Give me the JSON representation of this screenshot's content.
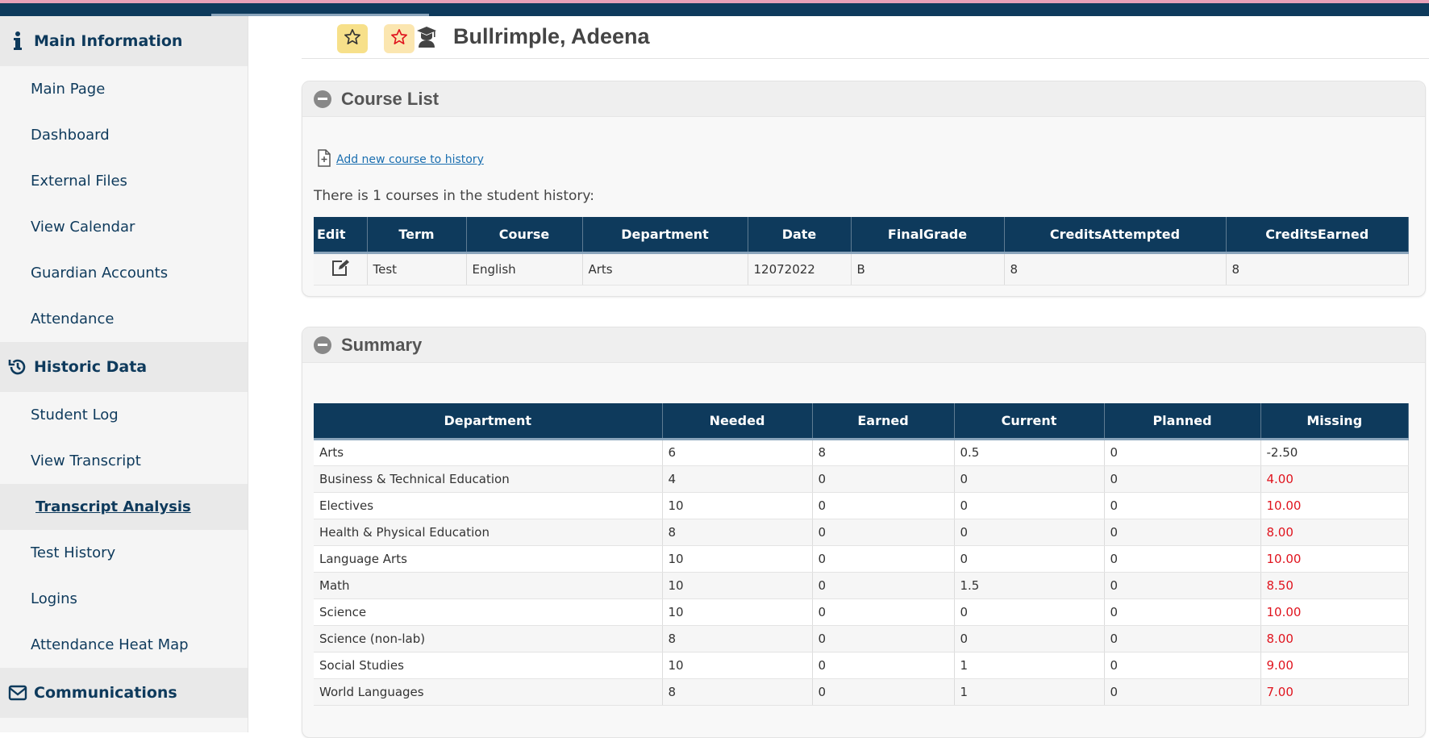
{
  "sidebar": {
    "sections": [
      {
        "label": "Main Information",
        "icon": "info-icon"
      },
      {
        "label": "Historic Data",
        "icon": "history-icon"
      },
      {
        "label": "Communications",
        "icon": "envelope-icon"
      }
    ],
    "main_items": [
      "Main Page",
      "Dashboard",
      "External Files",
      "View Calendar",
      "Guardian Accounts",
      "Attendance"
    ],
    "historic_items": [
      "Student Log",
      "View Transcript",
      "Transcript Analysis",
      "Test History",
      "Logins",
      "Attendance Heat Map"
    ],
    "active_item": "Transcript Analysis"
  },
  "header": {
    "student_name": "Bullrimple, Adeena"
  },
  "course_list": {
    "title": "Course List",
    "add_link": "Add new course to history",
    "count_text": "There is 1 courses in the student history:",
    "columns": [
      "Edit",
      "Term",
      "Course",
      "Department",
      "Date",
      "FinalGrade",
      "CreditsAttempted",
      "CreditsEarned"
    ],
    "rows": [
      {
        "term": "Test",
        "course": "English",
        "department": "Arts",
        "date": "12072022",
        "grade": "B",
        "attempted": "8",
        "earned": "8"
      }
    ]
  },
  "summary": {
    "title": "Summary",
    "columns": [
      "Department",
      "Needed",
      "Earned",
      "Current",
      "Planned",
      "Missing"
    ],
    "rows": [
      {
        "department": "Arts",
        "needed": "6",
        "earned": "8",
        "current": "0.5",
        "planned": "0",
        "missing": "-2.50",
        "deficit": false
      },
      {
        "department": "Business & Technical Education",
        "needed": "4",
        "earned": "0",
        "current": "0",
        "planned": "0",
        "missing": "4.00",
        "deficit": true
      },
      {
        "department": "Electives",
        "needed": "10",
        "earned": "0",
        "current": "0",
        "planned": "0",
        "missing": "10.00",
        "deficit": true
      },
      {
        "department": "Health & Physical Education",
        "needed": "8",
        "earned": "0",
        "current": "0",
        "planned": "0",
        "missing": "8.00",
        "deficit": true
      },
      {
        "department": "Language Arts",
        "needed": "10",
        "earned": "0",
        "current": "0",
        "planned": "0",
        "missing": "10.00",
        "deficit": true
      },
      {
        "department": "Math",
        "needed": "10",
        "earned": "0",
        "current": "1.5",
        "planned": "0",
        "missing": "8.50",
        "deficit": true
      },
      {
        "department": "Science",
        "needed": "10",
        "earned": "0",
        "current": "0",
        "planned": "0",
        "missing": "10.00",
        "deficit": true
      },
      {
        "department": "Science (non-lab)",
        "needed": "8",
        "earned": "0",
        "current": "0",
        "planned": "0",
        "missing": "8.00",
        "deficit": true
      },
      {
        "department": "Social Studies",
        "needed": "10",
        "earned": "0",
        "current": "1",
        "planned": "0",
        "missing": "9.00",
        "deficit": true
      },
      {
        "department": "World Languages",
        "needed": "8",
        "earned": "0",
        "current": "1",
        "planned": "0",
        "missing": "7.00",
        "deficit": true
      }
    ]
  },
  "colors": {
    "primary": "#0e3a5c",
    "deficit": "#e0141e",
    "star_bg": "#f7e08a"
  }
}
